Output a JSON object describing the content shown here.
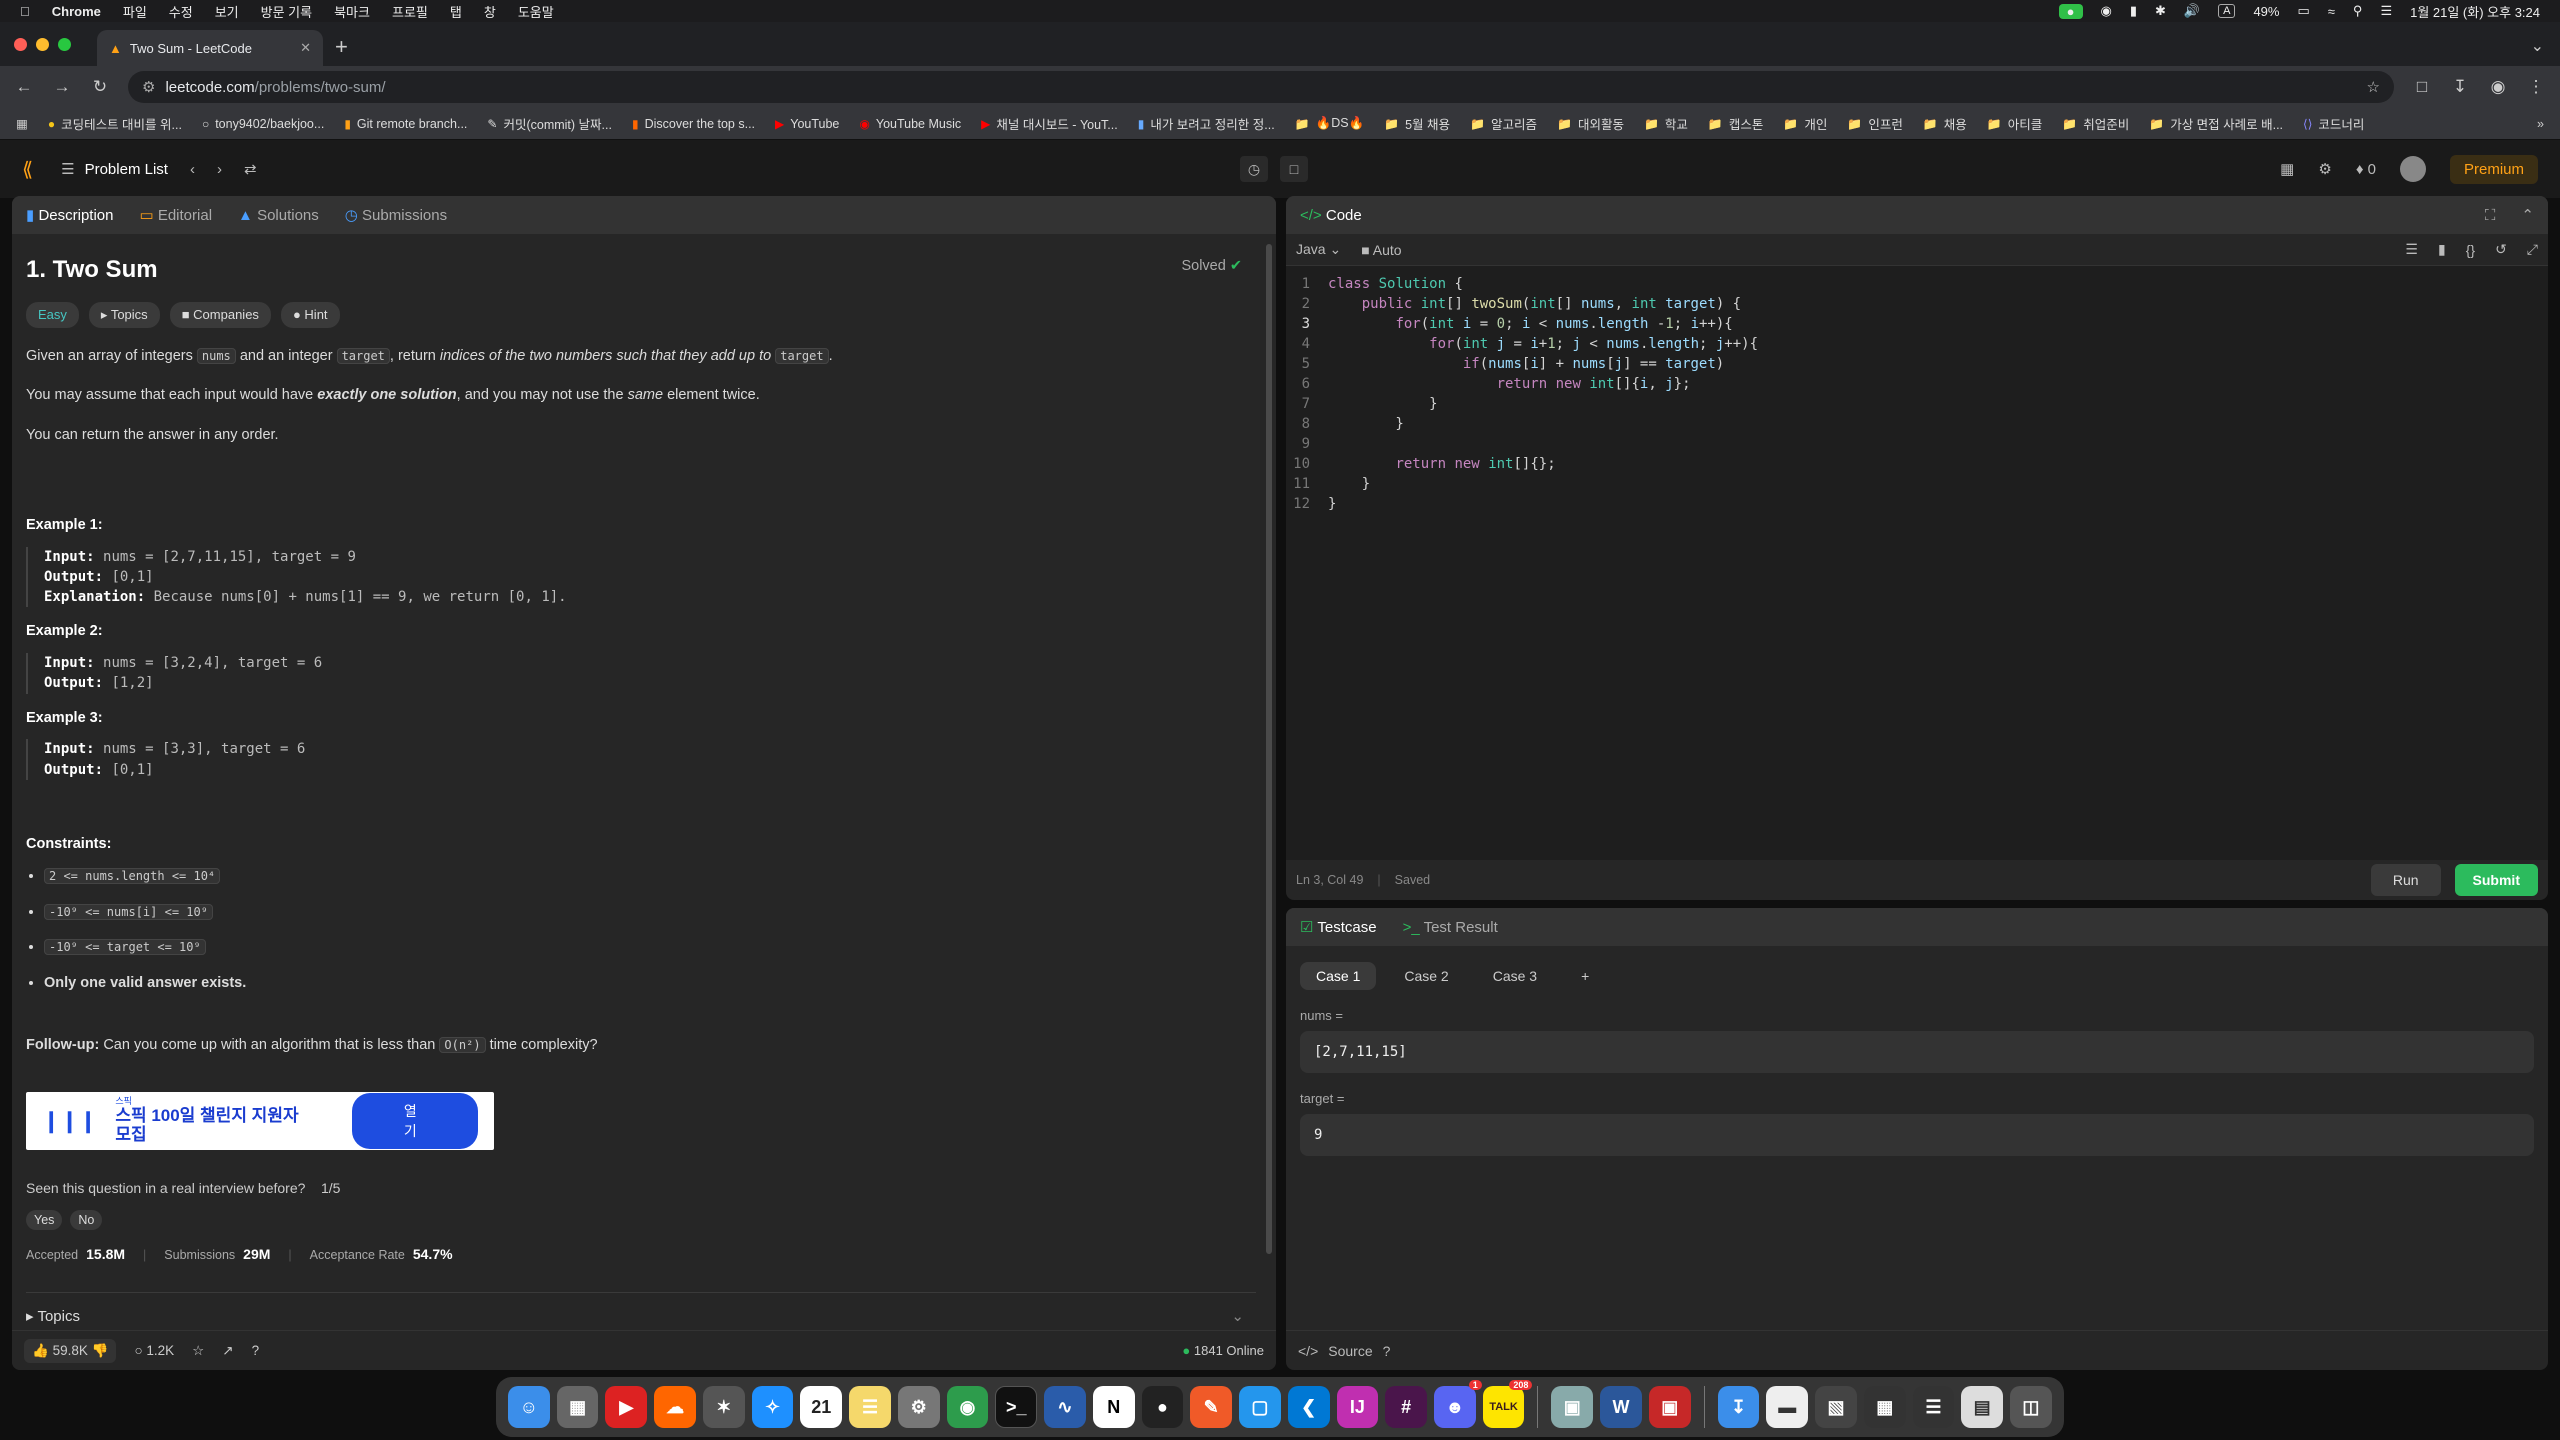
{
  "menubar": {
    "app": "Chrome",
    "items": [
      "파일",
      "수정",
      "보기",
      "방문 기록",
      "북마크",
      "프로필",
      "탭",
      "창",
      "도움말"
    ],
    "battery": "49%",
    "clock": "1월 21일 (화) 오후 3:24",
    "input_source": "A"
  },
  "browser": {
    "tab_title": "Two Sum - LeetCode",
    "url_host": "leetcode.com",
    "url_path": "/problems/two-sum/",
    "bookmarks": [
      "코딩테스트 대비를 위...",
      "tony9402/baekjoo...",
      "Git remote branch...",
      "커밋(commit) 날짜...",
      "Discover the top s...",
      "YouTube",
      "YouTube Music",
      "채널 대시보드 - YouT...",
      "내가 보려고 정리한 정...",
      "🔥DS🔥",
      "5월 채용",
      "알고리즘",
      "대외활동",
      "학교",
      "캡스톤",
      "개인",
      "인프런",
      "채용",
      "아티클",
      "취업준비",
      "가상 면접 사례로 배...",
      "코드너리"
    ]
  },
  "lc_header": {
    "problem_list": "Problem List",
    "streak": "0",
    "premium": "Premium"
  },
  "left_tabs": [
    "Description",
    "Editorial",
    "Solutions",
    "Submissions"
  ],
  "problem": {
    "title": "1. Two Sum",
    "solved": "Solved",
    "difficulty": "Easy",
    "chips": [
      "Topics",
      "Companies",
      "Hint"
    ],
    "p1_a": "Given an array of integers",
    "p1_code1": "nums",
    "p1_b": "and an integer",
    "p1_code2": "target",
    "p1_c": ", return",
    "p1_em": "indices of the two numbers such that they add up to",
    "p1_code3": "target",
    "p1_d": ".",
    "p2_a": "You may assume that each input would have",
    "p2_em": "exactly one solution",
    "p2_b": ", and you may not use the",
    "p2_em2": "same",
    "p2_c": "element twice.",
    "p3": "You can return the answer in any order.",
    "examples": [
      {
        "title": "Example 1:",
        "input": "nums = [2,7,11,15], target = 9",
        "output": "[0,1]",
        "explanation": "Because nums[0] + nums[1] == 9, we return [0, 1]."
      },
      {
        "title": "Example 2:",
        "input": "nums = [3,2,4], target = 6",
        "output": "[1,2]"
      },
      {
        "title": "Example 3:",
        "input": "nums = [3,3], target = 6",
        "output": "[0,1]"
      }
    ],
    "labels": {
      "input": "Input:",
      "output": "Output:",
      "explanation": "Explanation:"
    },
    "constraints_title": "Constraints:",
    "constraints": [
      "2 <= nums.length <= 10⁴",
      "-10⁹ <= nums[i] <= 10⁹",
      "-10⁹ <= target <= 10⁹"
    ],
    "constraint_last": "Only one valid answer exists.",
    "followup_label": "Follow-up:",
    "followup_a": "Can you come up with an algorithm that is less than",
    "followup_code": "O(n²)",
    "followup_b": "time complexity?"
  },
  "ad": {
    "brand": "스픽",
    "text": "스픽 100일 챌린지 지원자 모집",
    "button": "열기"
  },
  "interview": {
    "question": "Seen this question in a real interview before?",
    "page": "1/5",
    "yes": "Yes",
    "no": "No"
  },
  "stats": {
    "accepted_label": "Accepted",
    "accepted": "15.8M",
    "submissions_label": "Submissions",
    "submissions": "29M",
    "rate_label": "Acceptance Rate",
    "rate": "54.7%"
  },
  "topics_label": "Topics",
  "footer_left": {
    "likes": "59.8K",
    "comments": "1.2K",
    "online": "1841 Online"
  },
  "code": {
    "title": "Code",
    "language": "Java",
    "mode": "Auto",
    "lines": [
      "class Solution {",
      "    public int[] twoSum(int[] nums, int target) {",
      "        for(int i = 0; i < nums.length -1; i++){",
      "            for(int j = i+1; j < nums.length; j++){",
      "                if(nums[i] + nums[j] == target)",
      "                    return new int[]{i, j};",
      "            }",
      "        }",
      "",
      "        return new int[]{};",
      "    }",
      "}"
    ],
    "status": "Ln 3, Col 49",
    "saved": "Saved",
    "run": "Run",
    "submit": "Submit"
  },
  "testcase": {
    "tab1": "Testcase",
    "tab2": "Test Result",
    "cases": [
      "Case 1",
      "Case 2",
      "Case 3"
    ],
    "fields": [
      {
        "label": "nums =",
        "value": "[2,7,11,15]"
      },
      {
        "label": "target =",
        "value": "9"
      }
    ],
    "source": "Source"
  },
  "dock_badges": {
    "discord": "1",
    "kakao": "208",
    "calendar_day": "21"
  }
}
